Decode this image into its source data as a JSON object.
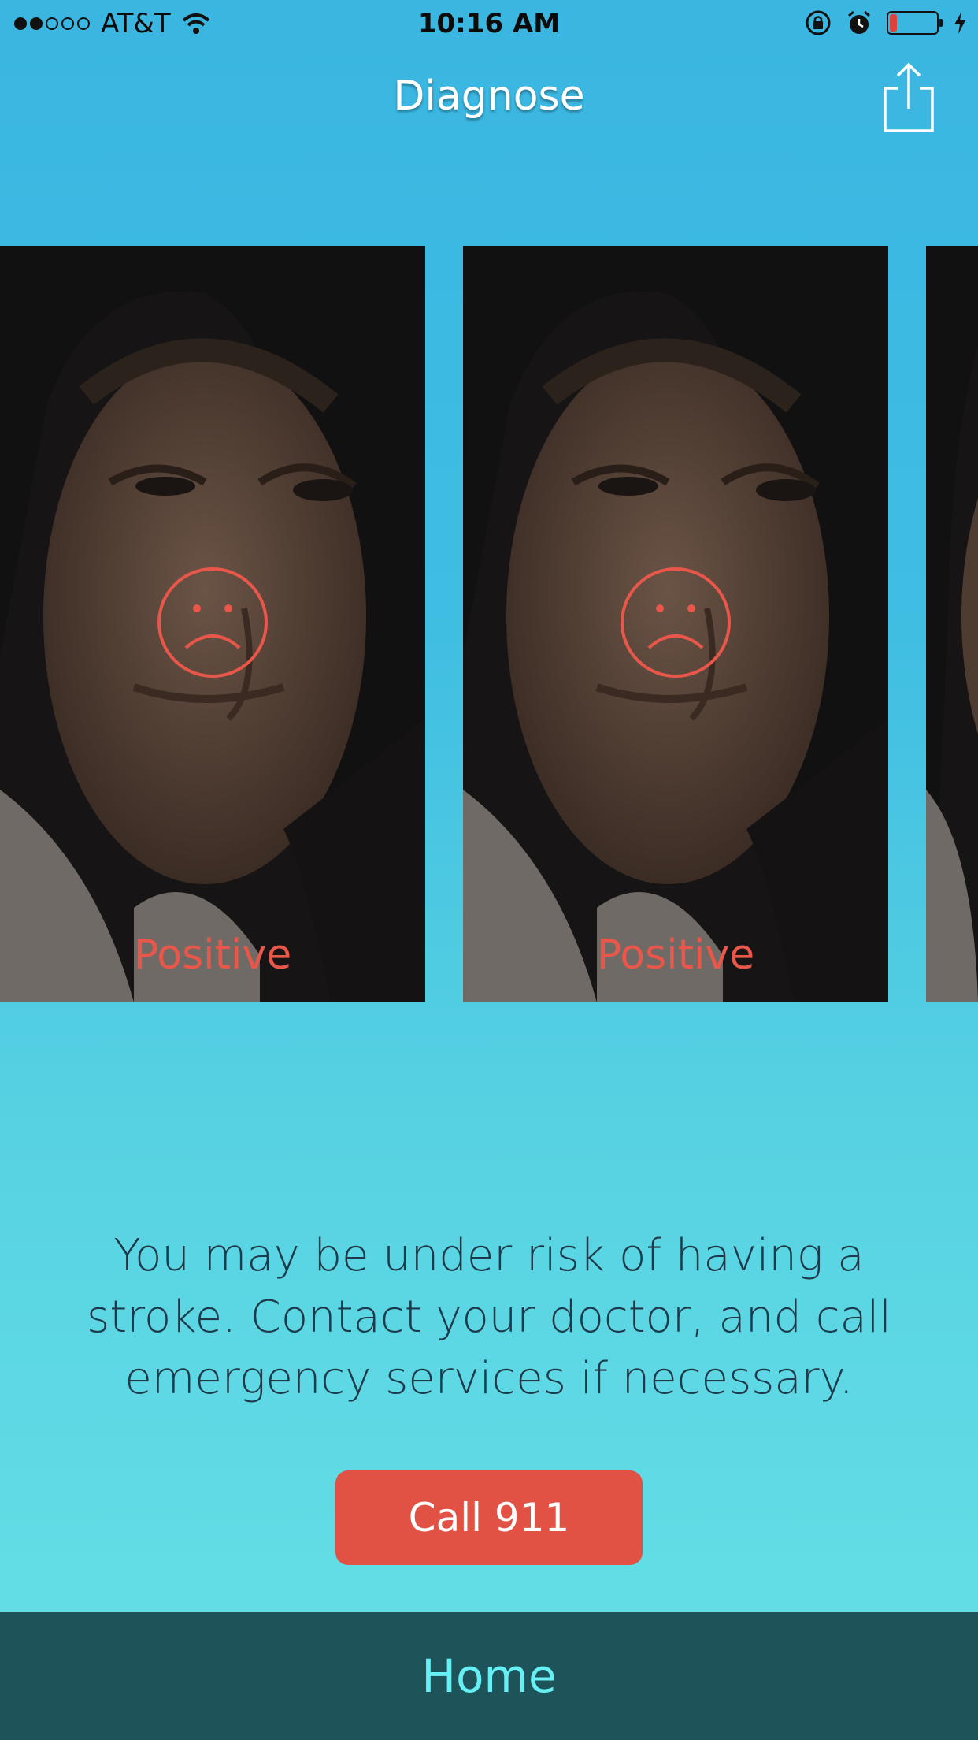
{
  "status_bar": {
    "carrier": "AT&T",
    "time": "10:16 AM",
    "signal_bars_filled": 2,
    "signal_bars_total": 5,
    "battery_level": 0.15,
    "battery_color": "#e0403a"
  },
  "header": {
    "title": "Diagnose",
    "share_icon": "share-icon"
  },
  "carousel": {
    "cards": [
      {
        "result": "Positive",
        "icon": "sad-face-icon"
      },
      {
        "result": "Positive",
        "icon": "sad-face-icon"
      },
      {
        "result": "",
        "icon": ""
      }
    ]
  },
  "message": {
    "lines": [
      "You may be under risk of having a",
      "stroke. Contact your doctor, and call",
      "emergency services if necessary."
    ]
  },
  "call_button": {
    "label": "Call 911",
    "color": "#e15245"
  },
  "tab_bar": {
    "home_label": "Home"
  },
  "colors": {
    "background_top": "#3ab6e1",
    "background_bottom": "#66e0e6",
    "result_text": "#e8574a",
    "tab_bar_bg": "#1e5459",
    "tab_bar_text": "#66f0f5"
  }
}
